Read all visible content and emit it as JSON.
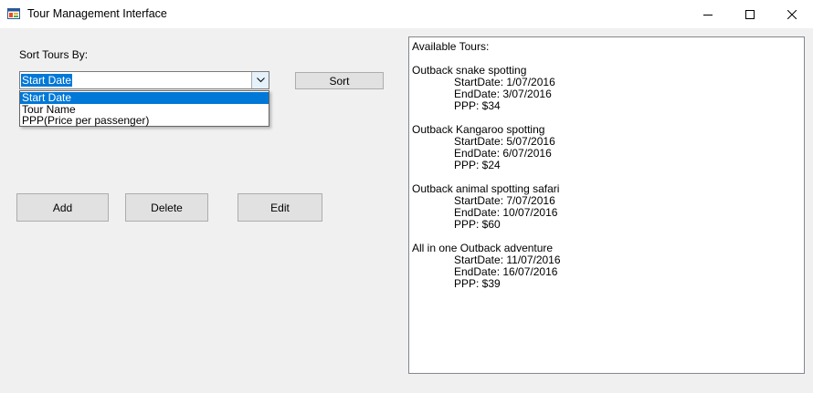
{
  "window": {
    "title": "Tour Management Interface"
  },
  "sort": {
    "label": "Sort Tours By:",
    "selected": "Start Date",
    "options": [
      "Start Date",
      "Tour Name",
      "PPP(Price per passenger)"
    ],
    "sort_button": "Sort"
  },
  "actions": {
    "add": "Add",
    "delete": "Delete",
    "edit": "Edit"
  },
  "tours_list": {
    "header": "Available Tours:",
    "tours": [
      {
        "name": "Outback snake spotting",
        "start": "StartDate: 1/07/2016",
        "end": "EndDate: 3/07/2016",
        "ppp": "PPP: $34"
      },
      {
        "name": "Outback Kangaroo spotting",
        "start": "StartDate: 5/07/2016",
        "end": "EndDate: 6/07/2016",
        "ppp": "PPP: $24"
      },
      {
        "name": "Outback animal spotting safari",
        "start": "StartDate: 7/07/2016",
        "end": "EndDate: 10/07/2016",
        "ppp": "PPP: $60"
      },
      {
        "name": "All in one Outback adventure",
        "start": "StartDate: 11/07/2016",
        "end": "EndDate: 16/07/2016",
        "ppp": "PPP: $39"
      }
    ]
  },
  "colors": {
    "selection": "#0078d7",
    "button_face": "#e1e1e1",
    "window_bg": "#f0f0f0"
  },
  "icons": {
    "app": "app-window-icon",
    "minimize": "minimize-icon",
    "maximize": "maximize-icon",
    "close": "close-icon",
    "dropdown": "chevron-down-icon"
  }
}
